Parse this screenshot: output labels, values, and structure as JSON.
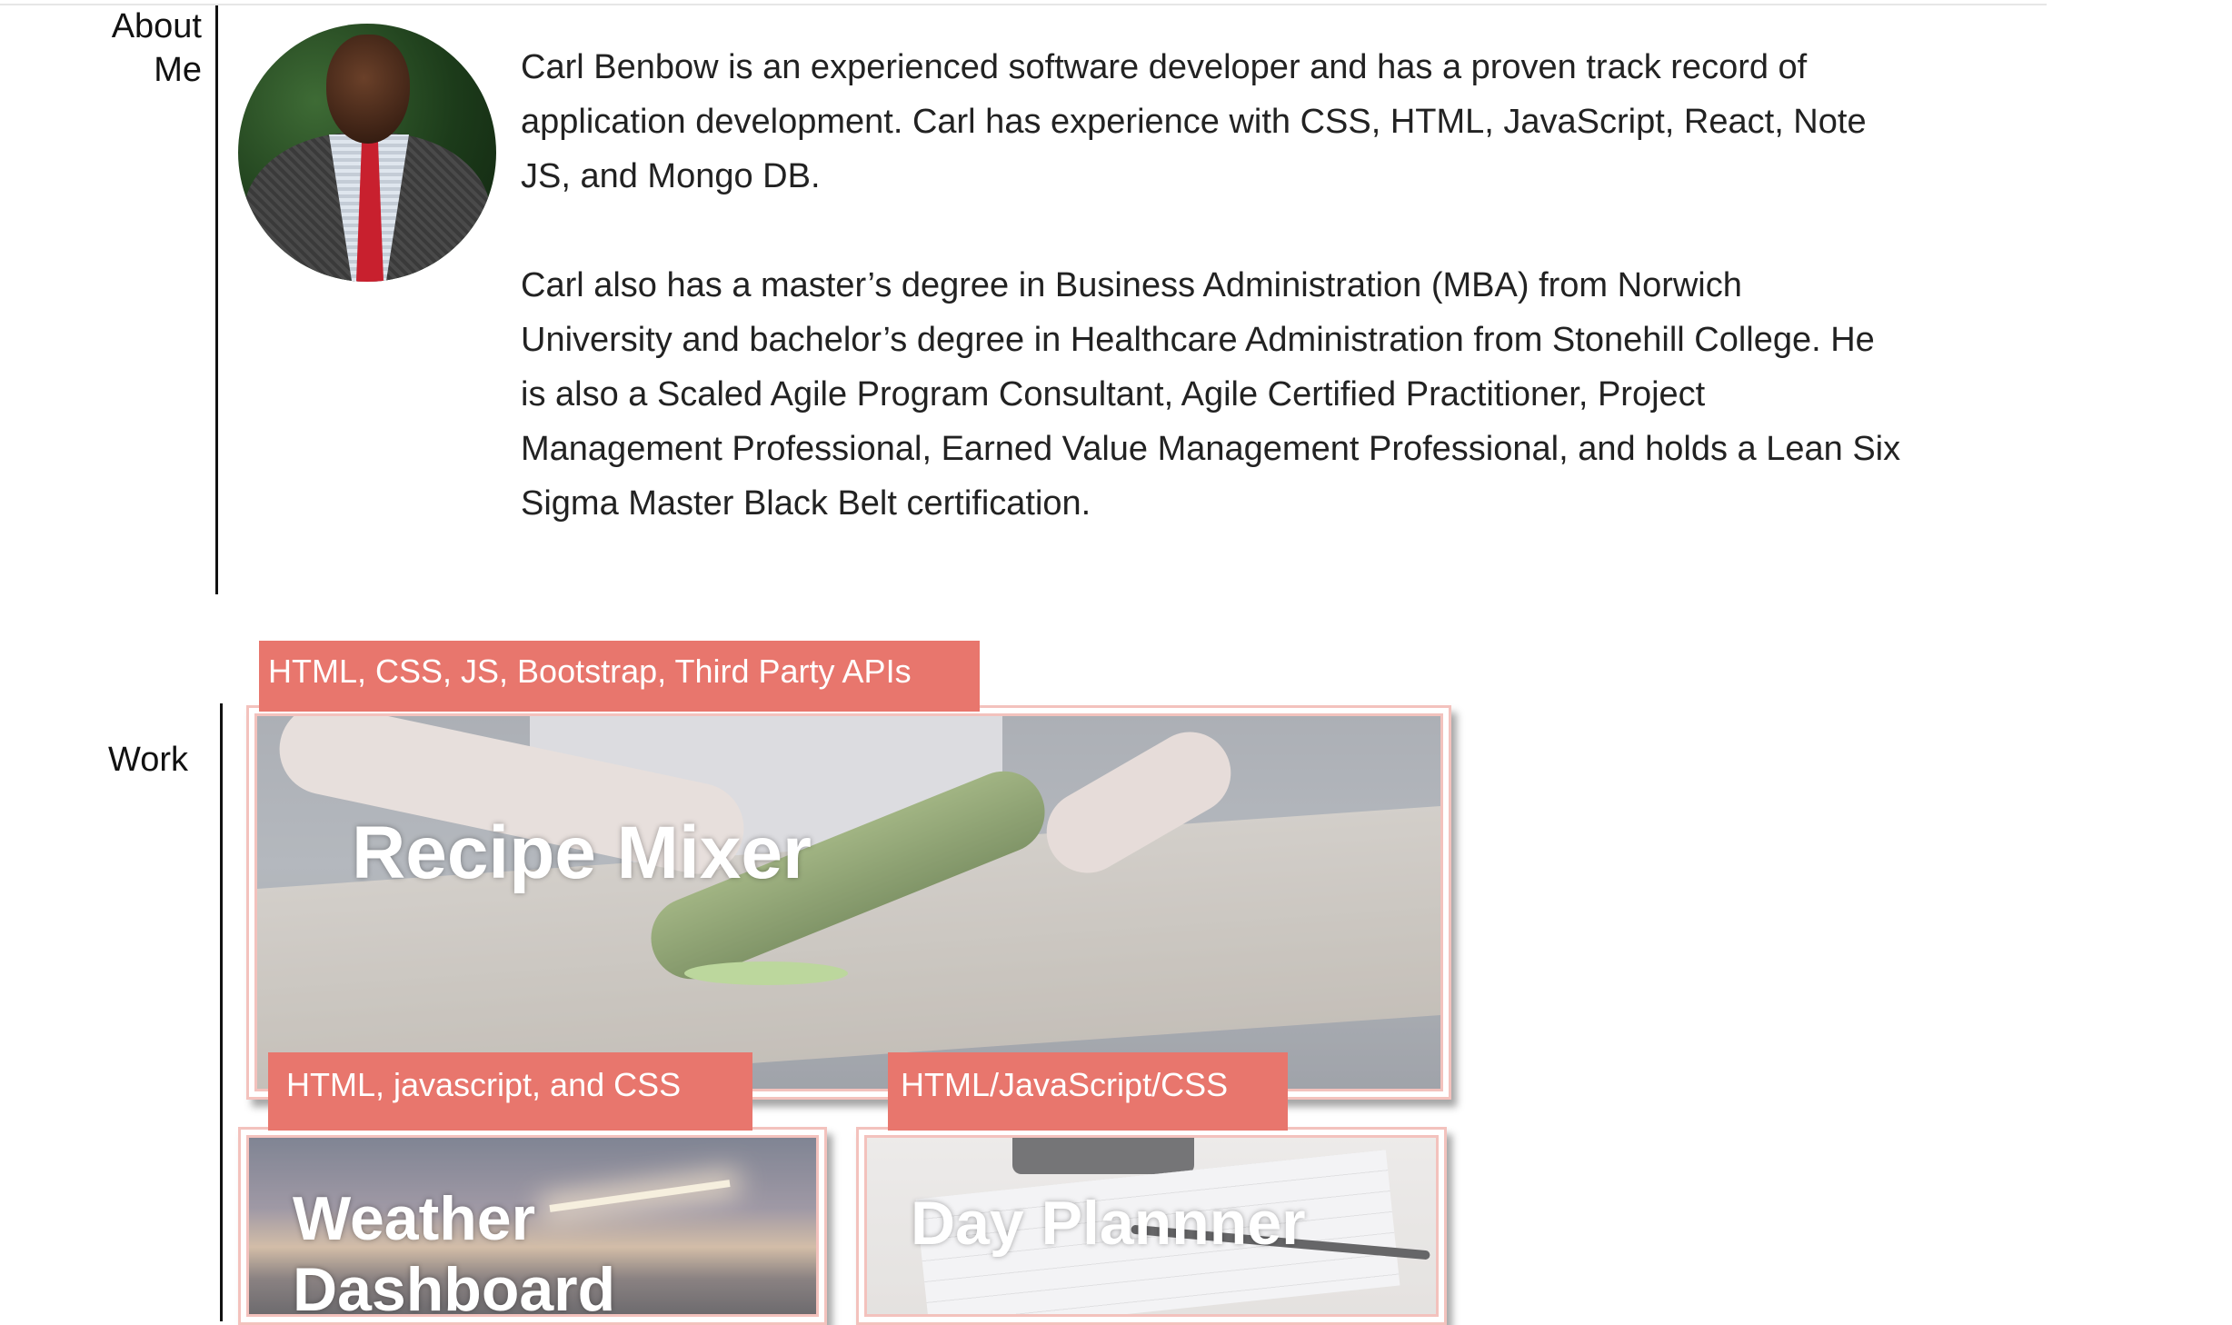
{
  "about": {
    "label_line1": "About",
    "label_line2": "Me",
    "paragraphs": [
      "Carl Benbow is an experienced software developer and has a proven track record of application development. Carl has experience with CSS, HTML, JavaScript, React, Note JS, and Mongo DB.",
      "Carl also has a master’s degree in Business Administration (MBA) from Norwich University and bachelor’s degree in Healthcare Administration from Stonehill College. He is also a Scaled Agile Program Consultant, Agile Certified Practitioner, Project Management Professional, Earned Value Management Professional, and holds a Lean Six Sigma Master Black Belt certification."
    ]
  },
  "work": {
    "label": "Work",
    "projects": [
      {
        "title": "Recipe Mixer",
        "tag": "HTML, CSS, JS, Bootstrap, Third Party APIs"
      },
      {
        "title": "Weather Dashboard",
        "title_line1": "Weather",
        "title_line2": "Dashboard",
        "tag": "HTML, javascript, and CSS"
      },
      {
        "title": "Day Plannner",
        "tag": "HTML/JavaScript/CSS"
      }
    ]
  },
  "colors": {
    "tag_background": "#e8766d",
    "card_border": "#f3c2bd"
  }
}
